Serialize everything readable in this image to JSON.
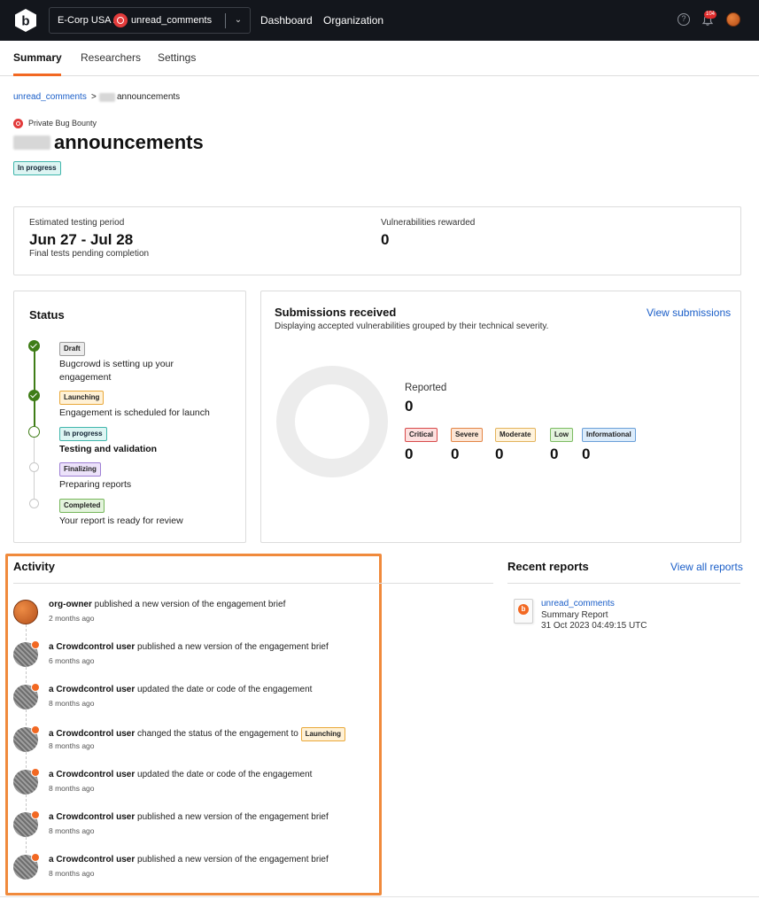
{
  "topnav": {
    "org": "E-Corp USA /",
    "program": "unread_comments",
    "links": [
      "Dashboard",
      "Organization"
    ],
    "notifications": "104"
  },
  "tabs": [
    "Summary",
    "Researchers",
    "Settings"
  ],
  "breadcrumb": {
    "parent": "unread_comments",
    "separator": ">",
    "current": "announcements"
  },
  "program": {
    "type": "Private Bug Bounty",
    "title": "announcements",
    "status": "In progress"
  },
  "overview": {
    "period_label": "Estimated testing period",
    "period_value": "Jun 27 - Jul 28",
    "period_note": "Final tests pending completion",
    "rewarded_label": "Vulnerabilities rewarded",
    "rewarded_value": "0"
  },
  "status": {
    "title": "Status",
    "steps": [
      {
        "tag": "Draft",
        "desc": "Bugcrowd is setting up your engagement"
      },
      {
        "tag": "Launching",
        "desc": "Engagement is scheduled for launch"
      },
      {
        "tag": "In progress",
        "desc": "Testing and validation"
      },
      {
        "tag": "Finalizing",
        "desc": "Preparing reports"
      },
      {
        "tag": "Completed",
        "desc": "Your report is ready for review"
      }
    ]
  },
  "submissions": {
    "title": "Submissions received",
    "link": "View submissions",
    "subtitle": "Displaying accepted vulnerabilities grouped by their technical severity.",
    "reported_label": "Reported",
    "reported_value": "0",
    "severities": [
      {
        "label": "Critical",
        "value": "0"
      },
      {
        "label": "Severe",
        "value": "0"
      },
      {
        "label": "Moderate",
        "value": "0"
      },
      {
        "label": "Low",
        "value": "0"
      },
      {
        "label": "Informational",
        "value": "0"
      }
    ]
  },
  "activity": {
    "title": "Activity",
    "items": [
      {
        "user": "org-owner",
        "action": "published a new version of the engagement brief",
        "time": "2 months ago"
      },
      {
        "user": "a Crowdcontrol user",
        "action": "published a new version of the engagement brief",
        "time": "6 months ago"
      },
      {
        "user": "a Crowdcontrol user",
        "action": "updated the date or code of the engagement",
        "time": "8 months ago"
      },
      {
        "user": "a Crowdcontrol user",
        "action": "changed the status of the engagement to",
        "tag": "Launching",
        "time": "8 months ago"
      },
      {
        "user": "a Crowdcontrol user",
        "action": "updated the date or code of the engagement",
        "time": "8 months ago"
      },
      {
        "user": "a Crowdcontrol user",
        "action": "published a new version of the engagement brief",
        "time": "8 months ago"
      },
      {
        "user": "a Crowdcontrol user",
        "action": "published a new version of the engagement brief",
        "time": "8 months ago"
      }
    ]
  },
  "reports": {
    "title": "Recent reports",
    "link": "View all reports",
    "items": [
      {
        "name": "unread_comments",
        "type": "Summary Report",
        "date": "31 Oct 2023 04:49:15 UTC"
      }
    ]
  },
  "colors": {
    "accent": "#f26822",
    "nav_bg": "#13161c",
    "link": "#1a5ec8",
    "highlight": "#f08a3c"
  }
}
